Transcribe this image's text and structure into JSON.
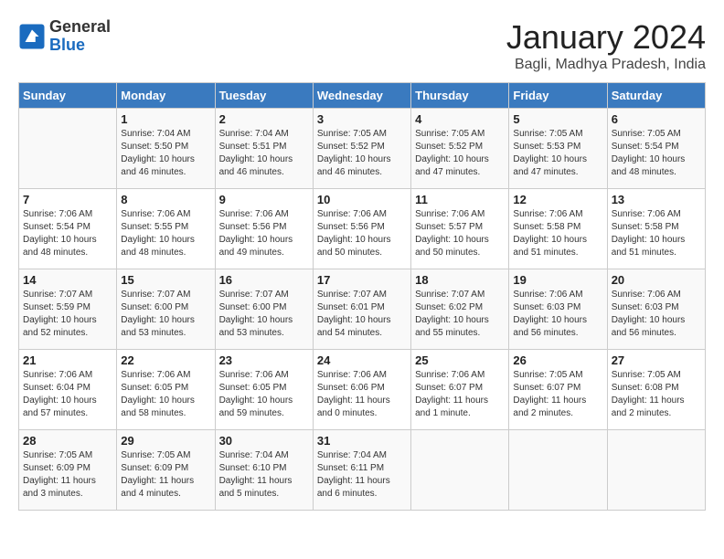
{
  "header": {
    "logo": {
      "general": "General",
      "blue": "Blue"
    },
    "title": "January 2024",
    "subtitle": "Bagli, Madhya Pradesh, India"
  },
  "days_of_week": [
    "Sunday",
    "Monday",
    "Tuesday",
    "Wednesday",
    "Thursday",
    "Friday",
    "Saturday"
  ],
  "weeks": [
    [
      {
        "day": "",
        "info": ""
      },
      {
        "day": "1",
        "info": "Sunrise: 7:04 AM\nSunset: 5:50 PM\nDaylight: 10 hours\nand 46 minutes."
      },
      {
        "day": "2",
        "info": "Sunrise: 7:04 AM\nSunset: 5:51 PM\nDaylight: 10 hours\nand 46 minutes."
      },
      {
        "day": "3",
        "info": "Sunrise: 7:05 AM\nSunset: 5:52 PM\nDaylight: 10 hours\nand 46 minutes."
      },
      {
        "day": "4",
        "info": "Sunrise: 7:05 AM\nSunset: 5:52 PM\nDaylight: 10 hours\nand 47 minutes."
      },
      {
        "day": "5",
        "info": "Sunrise: 7:05 AM\nSunset: 5:53 PM\nDaylight: 10 hours\nand 47 minutes."
      },
      {
        "day": "6",
        "info": "Sunrise: 7:05 AM\nSunset: 5:54 PM\nDaylight: 10 hours\nand 48 minutes."
      }
    ],
    [
      {
        "day": "7",
        "info": "Sunrise: 7:06 AM\nSunset: 5:54 PM\nDaylight: 10 hours\nand 48 minutes."
      },
      {
        "day": "8",
        "info": "Sunrise: 7:06 AM\nSunset: 5:55 PM\nDaylight: 10 hours\nand 48 minutes."
      },
      {
        "day": "9",
        "info": "Sunrise: 7:06 AM\nSunset: 5:56 PM\nDaylight: 10 hours\nand 49 minutes."
      },
      {
        "day": "10",
        "info": "Sunrise: 7:06 AM\nSunset: 5:56 PM\nDaylight: 10 hours\nand 50 minutes."
      },
      {
        "day": "11",
        "info": "Sunrise: 7:06 AM\nSunset: 5:57 PM\nDaylight: 10 hours\nand 50 minutes."
      },
      {
        "day": "12",
        "info": "Sunrise: 7:06 AM\nSunset: 5:58 PM\nDaylight: 10 hours\nand 51 minutes."
      },
      {
        "day": "13",
        "info": "Sunrise: 7:06 AM\nSunset: 5:58 PM\nDaylight: 10 hours\nand 51 minutes."
      }
    ],
    [
      {
        "day": "14",
        "info": "Sunrise: 7:07 AM\nSunset: 5:59 PM\nDaylight: 10 hours\nand 52 minutes."
      },
      {
        "day": "15",
        "info": "Sunrise: 7:07 AM\nSunset: 6:00 PM\nDaylight: 10 hours\nand 53 minutes."
      },
      {
        "day": "16",
        "info": "Sunrise: 7:07 AM\nSunset: 6:00 PM\nDaylight: 10 hours\nand 53 minutes."
      },
      {
        "day": "17",
        "info": "Sunrise: 7:07 AM\nSunset: 6:01 PM\nDaylight: 10 hours\nand 54 minutes."
      },
      {
        "day": "18",
        "info": "Sunrise: 7:07 AM\nSunset: 6:02 PM\nDaylight: 10 hours\nand 55 minutes."
      },
      {
        "day": "19",
        "info": "Sunrise: 7:06 AM\nSunset: 6:03 PM\nDaylight: 10 hours\nand 56 minutes."
      },
      {
        "day": "20",
        "info": "Sunrise: 7:06 AM\nSunset: 6:03 PM\nDaylight: 10 hours\nand 56 minutes."
      }
    ],
    [
      {
        "day": "21",
        "info": "Sunrise: 7:06 AM\nSunset: 6:04 PM\nDaylight: 10 hours\nand 57 minutes."
      },
      {
        "day": "22",
        "info": "Sunrise: 7:06 AM\nSunset: 6:05 PM\nDaylight: 10 hours\nand 58 minutes."
      },
      {
        "day": "23",
        "info": "Sunrise: 7:06 AM\nSunset: 6:05 PM\nDaylight: 10 hours\nand 59 minutes."
      },
      {
        "day": "24",
        "info": "Sunrise: 7:06 AM\nSunset: 6:06 PM\nDaylight: 11 hours\nand 0 minutes."
      },
      {
        "day": "25",
        "info": "Sunrise: 7:06 AM\nSunset: 6:07 PM\nDaylight: 11 hours\nand 1 minute."
      },
      {
        "day": "26",
        "info": "Sunrise: 7:05 AM\nSunset: 6:07 PM\nDaylight: 11 hours\nand 2 minutes."
      },
      {
        "day": "27",
        "info": "Sunrise: 7:05 AM\nSunset: 6:08 PM\nDaylight: 11 hours\nand 2 minutes."
      }
    ],
    [
      {
        "day": "28",
        "info": "Sunrise: 7:05 AM\nSunset: 6:09 PM\nDaylight: 11 hours\nand 3 minutes."
      },
      {
        "day": "29",
        "info": "Sunrise: 7:05 AM\nSunset: 6:09 PM\nDaylight: 11 hours\nand 4 minutes."
      },
      {
        "day": "30",
        "info": "Sunrise: 7:04 AM\nSunset: 6:10 PM\nDaylight: 11 hours\nand 5 minutes."
      },
      {
        "day": "31",
        "info": "Sunrise: 7:04 AM\nSunset: 6:11 PM\nDaylight: 11 hours\nand 6 minutes."
      },
      {
        "day": "",
        "info": ""
      },
      {
        "day": "",
        "info": ""
      },
      {
        "day": "",
        "info": ""
      }
    ]
  ]
}
